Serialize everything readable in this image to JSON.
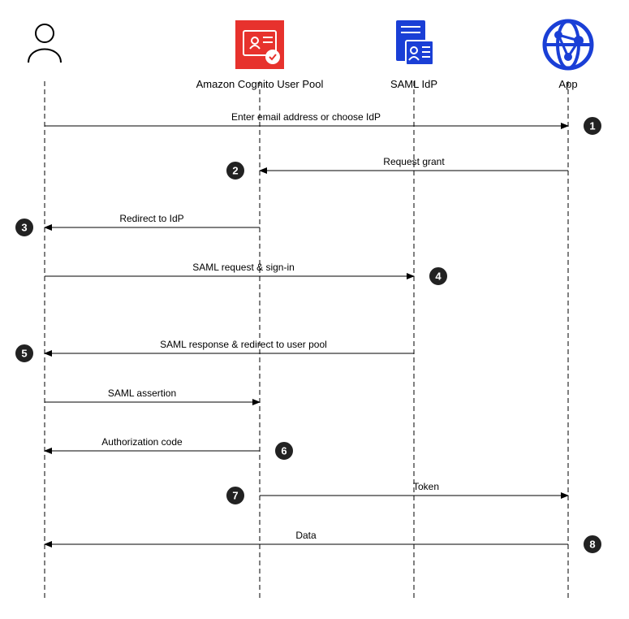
{
  "actors": {
    "user": "",
    "cognito": "Amazon Cognito User Pool",
    "idp": "SAML IdP",
    "app": "App"
  },
  "messages": {
    "m1": "Enter email address or choose IdP",
    "m2": "Request grant",
    "m3": "Redirect to IdP",
    "m4": "SAML request & sign-in",
    "m5": "SAML response & redirect to user pool",
    "m6a": "SAML assertion",
    "m6b": "Authorization code",
    "m7": "Token",
    "m8": "Data"
  },
  "steps": {
    "s1": "1",
    "s2": "2",
    "s3": "3",
    "s4": "4",
    "s5": "5",
    "s6": "6",
    "s7": "7",
    "s8": "8"
  }
}
